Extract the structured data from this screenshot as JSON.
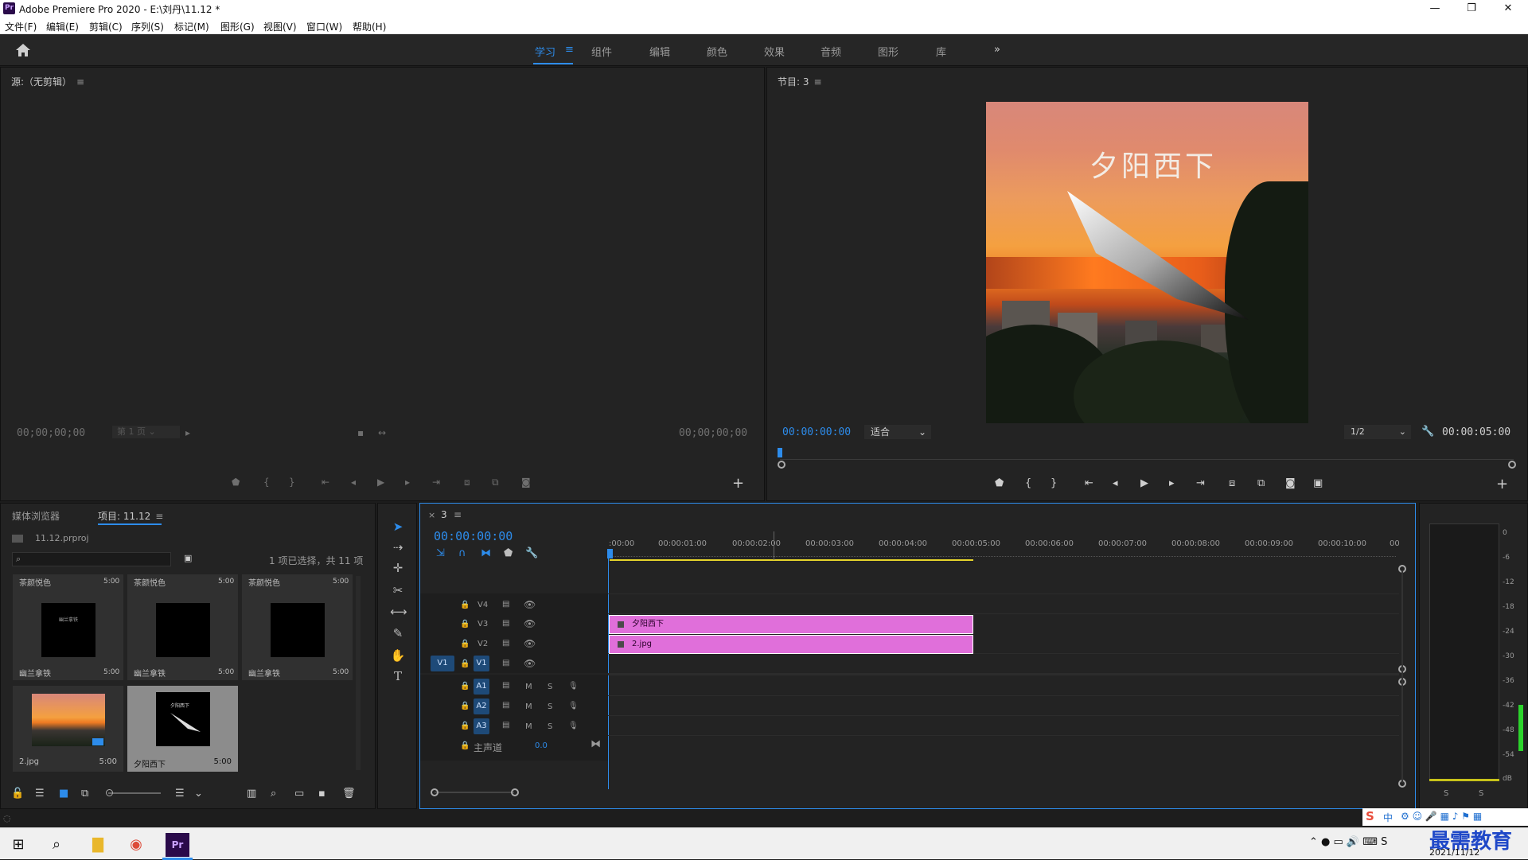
{
  "titlebar": {
    "app_icon": "Pr",
    "title": "Adobe Premiere Pro 2020 - E:\\刘丹\\11.12 *",
    "minimize": "—",
    "restore": "❐",
    "close": "✕"
  },
  "menu": [
    "文件(F)",
    "编辑(E)",
    "剪辑(C)",
    "序列(S)",
    "标记(M)",
    "图形(G)",
    "视图(V)",
    "窗口(W)",
    "帮助(H)"
  ],
  "workspaces": {
    "tabs": [
      "学习",
      "组件",
      "编辑",
      "颜色",
      "效果",
      "音频",
      "图形",
      "库"
    ],
    "active": "学习",
    "more": "»",
    "menu_icon": "≡"
  },
  "source_monitor": {
    "title": "源:（无剪辑）",
    "timecode_left": "00;00;00;00",
    "page_select": "第 1 页",
    "timecode_right": "00;00;00;00",
    "add": "+"
  },
  "program_monitor": {
    "title": "节目: 3",
    "overlay_text": "夕阳西下",
    "timecode": "00:00:00:00",
    "zoom": "适合",
    "resolution": "1/2",
    "duration": "00:00:05:00",
    "add": "+"
  },
  "project_panel": {
    "tab_media": "媒体浏览器",
    "tab_project": "项目: 11.12",
    "file": "11.12.prproj",
    "selection_info": "1 项已选择，共 11 项",
    "items_top": [
      {
        "name": "茶颜悦色",
        "dur": "5:00"
      },
      {
        "name": "茶颜悦色",
        "dur": "5:00"
      },
      {
        "name": "茶颜悦色",
        "dur": "5:00"
      }
    ],
    "items_mid": [
      {
        "name": "幽兰拿铁",
        "dur": "5:00"
      },
      {
        "name": "幽兰拿铁",
        "dur": "5:00"
      },
      {
        "name": "幽兰拿铁",
        "dur": "5:00"
      }
    ],
    "items_bottom": [
      {
        "name": "2.jpg",
        "dur": "5:00"
      },
      {
        "name": "夕阳西下",
        "dur": "5:00"
      }
    ],
    "thumb_text_mid1": "幽兰拿铁",
    "thumb_text_sel": "夕阳西下"
  },
  "timeline": {
    "sequence": "3",
    "close": "×",
    "timecode": "00:00:00:00",
    "ruler": [
      ":00:00",
      "00:00:01:00",
      "00:00:02:00",
      "00:00:03:00",
      "00:00:04:00",
      "00:00:05:00",
      "00:00:06:00",
      "00:00:07:00",
      "00:00:08:00",
      "00:00:09:00",
      "00:00:10:00",
      "00"
    ],
    "video_tracks": [
      "V4",
      "V3",
      "V2",
      "V1"
    ],
    "source_patch": "V1",
    "audio_tracks": [
      "A1",
      "A2",
      "A3"
    ],
    "mute": "M",
    "solo": "S",
    "master_label": "主声道",
    "master_value": "0.0",
    "clips": [
      {
        "name": "夕阳西下",
        "track": "V3"
      },
      {
        "name": "2.jpg",
        "track": "V2"
      }
    ]
  },
  "audio_meter": {
    "scale": [
      "0",
      "-6",
      "-12",
      "-18",
      "-24",
      "-30",
      "-36",
      "-42",
      "-48",
      "-54",
      "dB"
    ],
    "solo": [
      "S",
      "S"
    ]
  },
  "tray": {
    "ime": "中",
    "date": "2021/11/12",
    "watermark": "最需教育"
  },
  "colors": {
    "accent": "#2d8ceb",
    "clip": "#e06fda",
    "track_btn": "#1e4a78",
    "background": "#1d1d1d"
  }
}
